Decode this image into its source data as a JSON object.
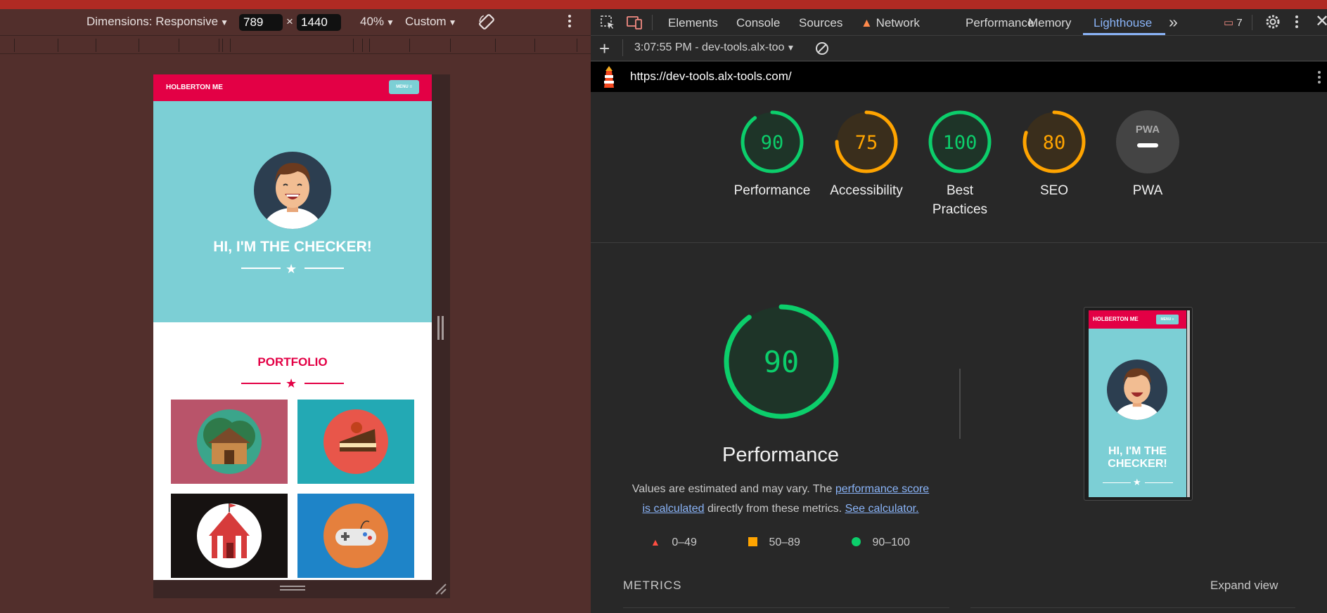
{
  "device_toolbar": {
    "dimensions_label": "Dimensions: Responsive",
    "width_value": "789",
    "times": "×",
    "height_value": "1440",
    "zoom": "40%",
    "throttle": "Custom"
  },
  "phone_page": {
    "brand": "HOLBERTON ME",
    "menu_label": "MENU ≡",
    "hero_title": "HI, I'M THE CHECKER!",
    "portfolio_title": "PORTFOLIO",
    "colors": {
      "brand_red": "#e30045",
      "hero_teal": "#7ccfd5"
    },
    "tiles": [
      {
        "name": "cabin-tile",
        "bg": "#b9546a",
        "icon": "cabin-icon"
      },
      {
        "name": "cake-tile",
        "bg": "#23a9b4",
        "icon": "cake-icon"
      },
      {
        "name": "circus-tile",
        "bg": "#161211",
        "icon": "circus-tent-icon"
      },
      {
        "name": "game-tile",
        "bg": "#1e84c8",
        "icon": "gamepad-icon"
      }
    ]
  },
  "devtools": {
    "tabs": [
      "Elements",
      "Console",
      "Sources",
      "Network",
      "Performance",
      "Memory",
      "Lighthouse"
    ],
    "active_tab": "Lighthouse",
    "more_tabs": "»",
    "issues_count": "7",
    "report_selector": "3:07:55 PM - dev-tools.alx-too",
    "url": "https://dev-tools.alx-tools.com/"
  },
  "lighthouse": {
    "scores": [
      {
        "label": "Performance",
        "value": "90",
        "color": "#0cce6b",
        "fraction": 0.9
      },
      {
        "label": "Accessibility",
        "value": "75",
        "color": "#ffa400",
        "fraction": 0.75
      },
      {
        "label_line1": "Best",
        "label_line2": "Practices",
        "value": "100",
        "color": "#0cce6b",
        "fraction": 1.0
      },
      {
        "label": "SEO",
        "value": "80",
        "color": "#ffa400",
        "fraction": 0.8
      },
      {
        "label": "PWA",
        "value": "",
        "color": "#9e9e9e",
        "fraction": 0
      }
    ],
    "pwa_badge_text": "PWA",
    "main_score": "90",
    "main_title": "Performance",
    "desc_prefix": "Values are estimated and may vary. The ",
    "desc_link1a": "performance score",
    "desc_link1b": "is calculated",
    "desc_middle": " directly from these metrics. ",
    "desc_link2": "See calculator.",
    "legend": [
      {
        "range": "0–49",
        "shape": "triangle",
        "color": "#ff4e42"
      },
      {
        "range": "50–89",
        "shape": "square",
        "color": "#ffa400"
      },
      {
        "range": "90–100",
        "shape": "circle",
        "color": "#0cce6b"
      }
    ],
    "metrics_heading": "METRICS",
    "expand_view": "Expand view"
  },
  "screenshot_preview": {
    "brand": "HOLBERTON ME",
    "menu_label": "MENU ≡",
    "title": "HI, I'M THE CHECKER!"
  }
}
